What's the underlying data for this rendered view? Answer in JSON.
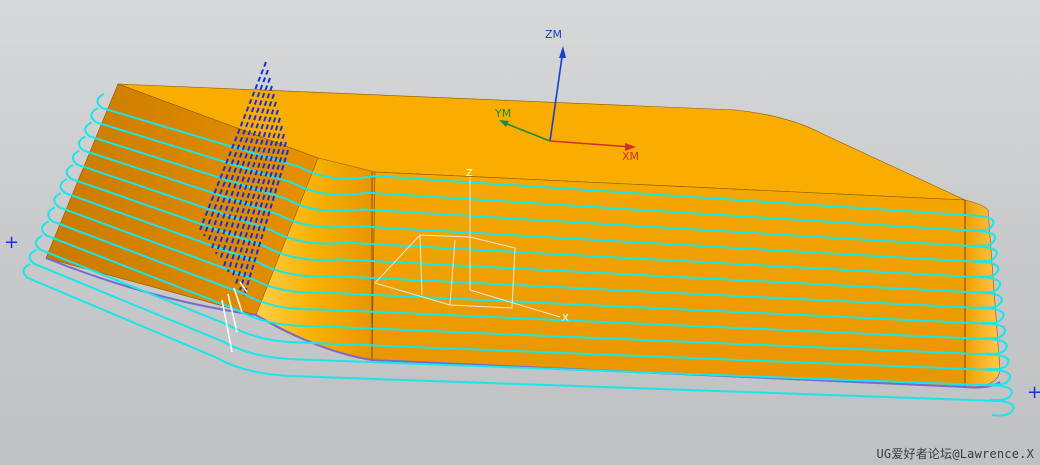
{
  "viewport": {
    "background": "#c9cbcd",
    "part_color": "#f4a500",
    "part_dark": "#d88a00",
    "toolpath_color": "#19e6ea",
    "plunge_color": "#1a2fd6"
  },
  "mcs": {
    "z_label": "ZM",
    "y_label": "YM",
    "x_label": "XM",
    "z_color": "#1a3fd0",
    "y_color": "#1f8a3a",
    "x_color": "#d0302a"
  },
  "wcs": {
    "z_label": "Z",
    "x_label": "X"
  },
  "markers": [
    "+",
    "+"
  ],
  "watermark": "UG爱好者论坛@Lawrence.X"
}
